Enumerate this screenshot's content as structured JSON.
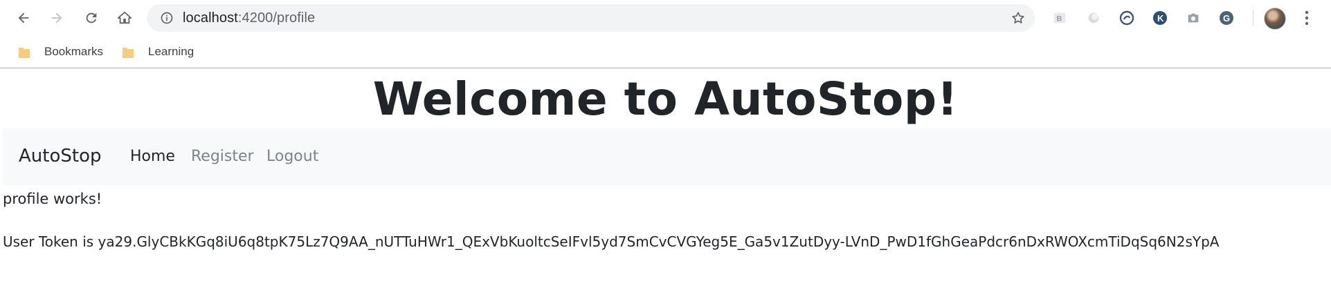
{
  "browser": {
    "url_host": "localhost",
    "url_rest": ":4200/profile",
    "bookmarks": [
      {
        "label": "Bookmarks"
      },
      {
        "label": "Learning"
      }
    ]
  },
  "page": {
    "heading": "Welcome to AutoStop!",
    "navbar": {
      "brand": "AutoStop",
      "links": [
        {
          "label": "Home",
          "active": true
        },
        {
          "label": "Register",
          "active": false
        },
        {
          "label": "Logout",
          "active": false
        }
      ]
    },
    "profile_text": "profile works!",
    "token_line": "User Token is ya29.GlyCBkKGq8iU6q8tpK75Lz7Q9AA_nUTTuHWr1_QExVbKuoltcSeIFvl5yd7SmCvCVGYeg5E_Ga5v1ZutDyy-LVnD_PwD1fGhGeaPdcr6nDxRWOXcmTiDqSq6N2sYpA"
  },
  "colors": {
    "navbar_bg": "#f8f9fa",
    "text_dark": "#212529",
    "link_muted": "#7b848c",
    "omnibox_bg": "#f1f3f4"
  }
}
